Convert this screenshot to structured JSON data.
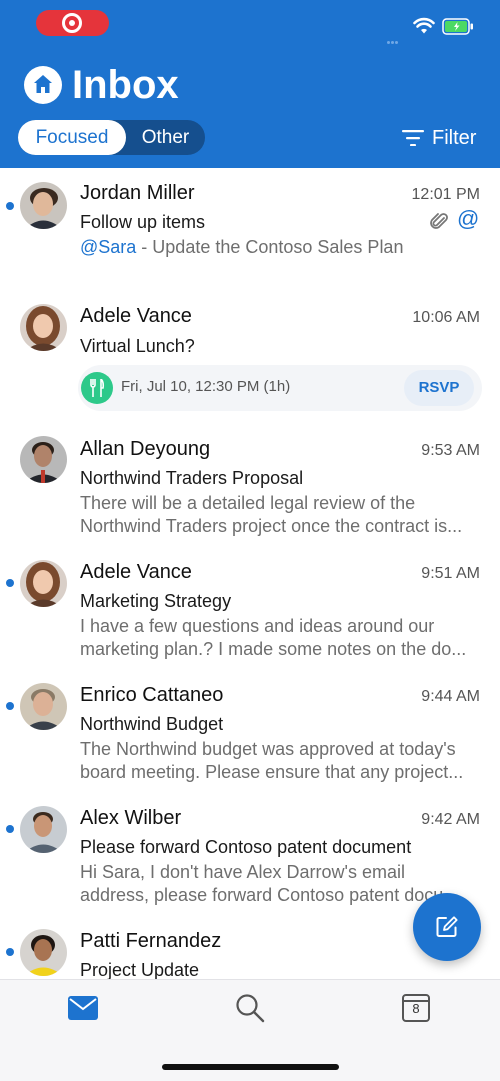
{
  "header": {
    "title": "Inbox",
    "tabs": [
      {
        "label": "Focused",
        "selected": true
      },
      {
        "label": "Other",
        "selected": false
      }
    ],
    "filter_label": "Filter"
  },
  "messages": [
    {
      "sender": "Jordan Miller",
      "time": "12:01 PM",
      "subject": "Follow up items",
      "mention": "@Sara",
      "preview_rest": " - Update the Contoso Sales Plan",
      "unread": true,
      "has_attachment": true,
      "mentions_me": true
    },
    {
      "sender": "Adele Vance",
      "time": "10:06 AM",
      "subject": "Virtual Lunch?",
      "unread": false,
      "event": {
        "text": "Fri, Jul 10, 12:30 PM (1h)",
        "rsvp_label": "RSVP"
      }
    },
    {
      "sender": "Allan Deyoung",
      "time": "9:53 AM",
      "subject": "Northwind Traders Proposal",
      "preview_line1": "There will be a detailed legal review of the",
      "preview_line2": "Northwind Traders project once the contract is...",
      "unread": false
    },
    {
      "sender": "Adele Vance",
      "time": "9:51 AM",
      "subject": "Marketing Strategy",
      "preview_line1": "I have a few questions and ideas around our",
      "preview_line2": "marketing plan.? I made some notes on the do...",
      "unread": true
    },
    {
      "sender": "Enrico Cattaneo",
      "time": "9:44 AM",
      "subject": "Northwind Budget",
      "preview_line1": "The Northwind budget was approved at today's",
      "preview_line2": "board meeting. Please ensure that any project...",
      "unread": true
    },
    {
      "sender": "Alex Wilber",
      "time": "9:42 AM",
      "subject": "Please forward Contoso patent document",
      "preview_line1": "Hi Sara, I don't have Alex Darrow's email",
      "preview_line2": "address, please forward Contoso patent docu...",
      "unread": true
    },
    {
      "sender": "Patti Fernandez",
      "time": "",
      "subject": "Project Update",
      "unread": true
    }
  ],
  "tab_bar": {
    "items": [
      "mail-icon",
      "search-icon",
      "calendar-icon"
    ],
    "calendar_day": "8"
  },
  "colors": {
    "accent": "#1d73cf",
    "header_bg": "#1d73cf",
    "event_icon": "#2dc98a",
    "recording": "#e5343b",
    "battery": "#4cd964"
  }
}
